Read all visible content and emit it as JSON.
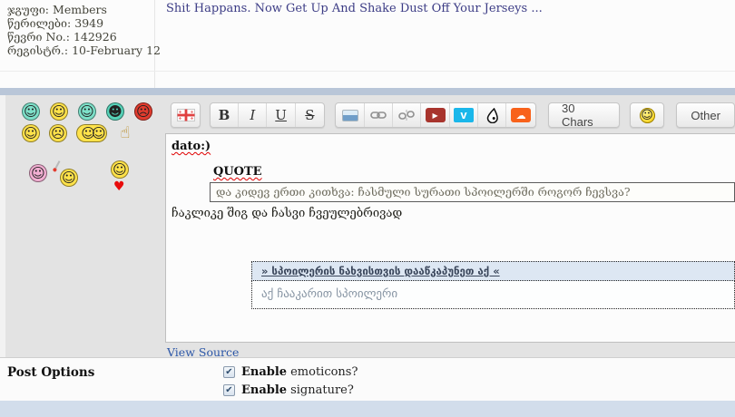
{
  "post_header": {
    "user_info": [
      {
        "label": "ჯგუფი:",
        "value": "Members"
      },
      {
        "label": "წერილები:",
        "value": "3949"
      },
      {
        "label": "წევრი No.:",
        "value": "142926"
      },
      {
        "label": "რეგისტრ.:",
        "value": "10-February 12"
      }
    ],
    "topic_title": "Shit Happans. Now Get Up And Shake Dust Off Your Jerseys ..."
  },
  "emoticon_rows": [
    [
      {
        "name": "emoticon-grin-braces",
        "bg": "#7de0c9",
        "glyph": "☺"
      },
      {
        "name": "emoticon-cry-laugh",
        "bg": "#ffe24a",
        "glyph": "☺"
      },
      {
        "name": "emoticon-big-grin",
        "bg": "#7de0c9",
        "glyph": "☺"
      },
      {
        "name": "emoticon-cool-shades",
        "bg": "#57d2b8",
        "glyph": "☻"
      },
      {
        "name": "emoticon-angry",
        "bg": "#e23b2e",
        "glyph": "☹"
      }
    ],
    [
      {
        "name": "emoticon-pray",
        "bg": "#ffe24a",
        "glyph": "☺"
      },
      {
        "name": "emoticon-facepalm",
        "bg": "#ffe24a",
        "glyph": "☹"
      },
      {
        "name": "emoticon-lol-pair",
        "bg": "#ffe24a",
        "glyph": "☺☺",
        "wide": true
      },
      {
        "name": "emoticon-thumbs-up",
        "flat": true,
        "glyph": "☝",
        "fg": "#b8891f"
      }
    ],
    [
      {
        "name": "emoticon-girl",
        "bg": "#f2aed2",
        "glyph": "☺",
        "cls": "girl"
      },
      {
        "name": "emoticon-smoking",
        "bg": "#ffe24a",
        "glyph": "☺",
        "cls": "smoking",
        "cig": true
      },
      {
        "name": "emoticon-love",
        "bg": "#ffe24a",
        "glyph": "☺",
        "cls": "love",
        "under": "♥"
      }
    ]
  ],
  "toolbar": {
    "bold_label": "B",
    "italic_label": "I",
    "underline_label": "U",
    "strike_label": "S",
    "youtube_glyph": "▶",
    "vimeo_label": "v",
    "soundcloud_glyph": "☁",
    "smiley_glyph": "☺",
    "char_count_label": "30 Chars",
    "other_label": "Other"
  },
  "editor": {
    "line1": "dato:)",
    "quote_label": "QUOTE",
    "quote_text": "და კიდევ ერთი კითხვა: ჩასმული სურათი სპოილერში როგორ ჩევსვა?",
    "reply_text": "ჩაკლიკე შიგ და ჩასვი ჩვეულებრივად",
    "spoiler_header": "» სპოილერის ნახვისთვის დააწკაპუნეთ აქ «",
    "spoiler_body": "აქ ჩააკარით სპოილერი",
    "view_source_label": "View Source"
  },
  "post_options": {
    "title": "Post Options",
    "options": [
      {
        "bold": "Enable",
        "rest": "emoticons?",
        "checked": true,
        "check_glyph": "✔"
      },
      {
        "bold": "Enable",
        "rest": "signature?",
        "checked": true,
        "check_glyph": "✔"
      }
    ]
  },
  "colors": {
    "band_top": "#b9c6d8",
    "band_bottom": "#d2ddeb",
    "title_link": "#3c3c85",
    "spoiler_header_bg": "#dde7f3",
    "youtube_red": "#a8342d",
    "vimeo_blue": "#1ab7ea",
    "soundcloud_orange": "#f8621b",
    "misspell_red": "#e00000"
  }
}
